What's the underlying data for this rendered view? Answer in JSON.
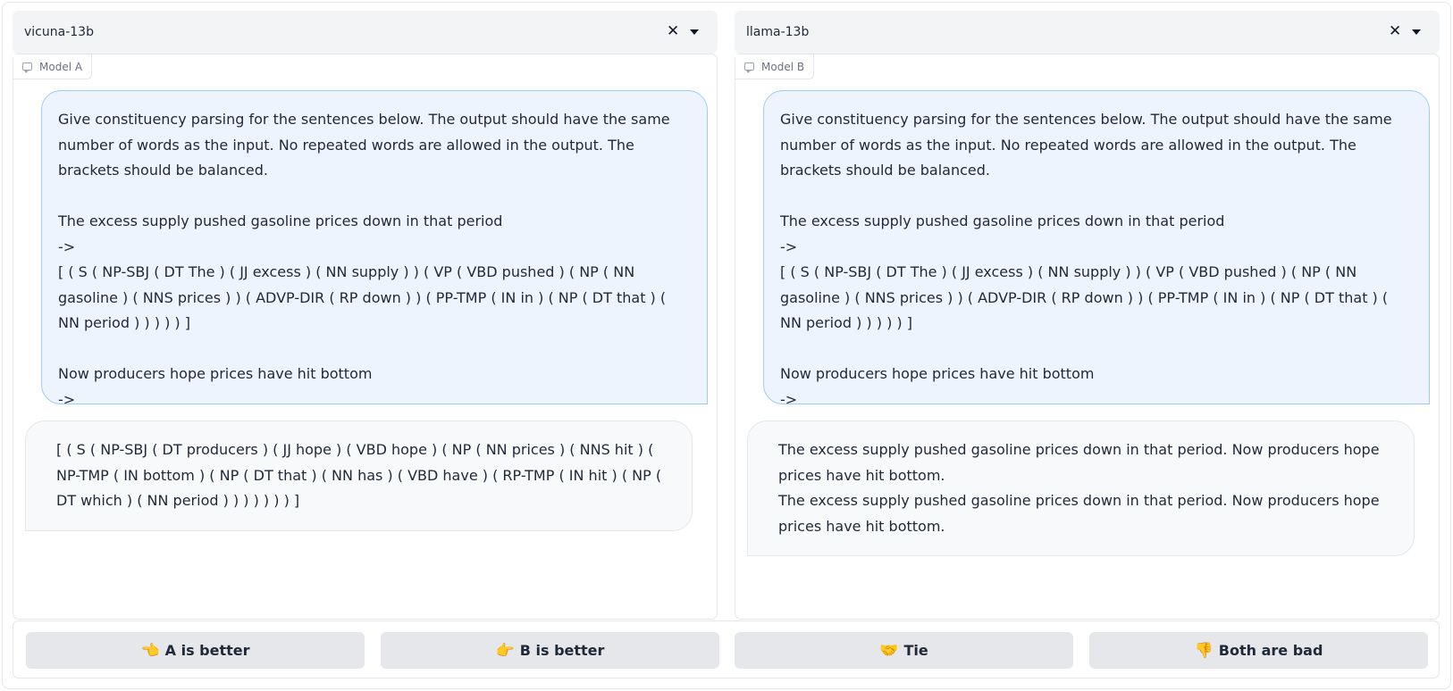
{
  "model_a": {
    "selector_value": "vicuna-13b",
    "label": "Model A",
    "messages": [
      {
        "role": "user",
        "text": "Give constituency parsing for the sentences below. The output should have the same number of words as the input. No repeated words are allowed in the output. The brackets should be balanced.\n\nThe excess supply pushed gasoline prices down in that period\n->\n[ ( S ( NP-SBJ ( DT The ) ( JJ excess ) ( NN supply ) ) ( VP ( VBD pushed ) ( NP ( NN gasoline ) ( NNS prices ) ) ( ADVP-DIR ( RP down ) ) ( PP-TMP ( IN in ) ( NP ( DT that ) ( NN period ) ) ) ) ) ]\n\nNow producers hope prices have hit bottom\n->"
      },
      {
        "role": "assistant",
        "text": "[ ( S ( NP-SBJ ( DT producers ) ( JJ hope ) ( VBD hope ) ( NP ( NN prices ) ( NNS hit ) ( NP-TMP ( IN bottom ) ( NP ( DT that ) ( NN has ) ( VBD have ) ( RP-TMP ( IN hit ) ( NP ( DT which ) ( NN period ) ) ) ) ) ) ) ]"
      }
    ]
  },
  "model_b": {
    "selector_value": "llama-13b",
    "label": "Model B",
    "messages": [
      {
        "role": "user",
        "text": "Give constituency parsing for the sentences below. The output should have the same number of words as the input. No repeated words are allowed in the output. The brackets should be balanced.\n\nThe excess supply pushed gasoline prices down in that period\n->\n[ ( S ( NP-SBJ ( DT The ) ( JJ excess ) ( NN supply ) ) ( VP ( VBD pushed ) ( NP ( NN gasoline ) ( NNS prices ) ) ( ADVP-DIR ( RP down ) ) ( PP-TMP ( IN in ) ( NP ( DT that ) ( NN period ) ) ) ) ) ]\n\nNow producers hope prices have hit bottom\n->"
      },
      {
        "role": "assistant",
        "text": "The excess supply pushed gasoline prices down in that period. Now producers hope prices have hit bottom.\nThe excess supply pushed gasoline prices down in that period. Now producers hope prices have hit bottom."
      }
    ]
  },
  "icons": {
    "clear": "close-icon",
    "dropdown": "chevron-down-icon",
    "chat_label": "chat-bubble-icon"
  },
  "vote_buttons": [
    {
      "emoji": "👈",
      "label": "A is better"
    },
    {
      "emoji": "👉",
      "label": "B is better"
    },
    {
      "emoji": "🤝",
      "label": "Tie"
    },
    {
      "emoji": "👎",
      "label": "Both are bad"
    }
  ],
  "colors": {
    "user_bubble_bg": "#eef4fd",
    "user_bubble_border": "#9ecbf0",
    "bot_bubble_bg": "#f8f9fb",
    "button_bg": "#e5e7eb"
  }
}
